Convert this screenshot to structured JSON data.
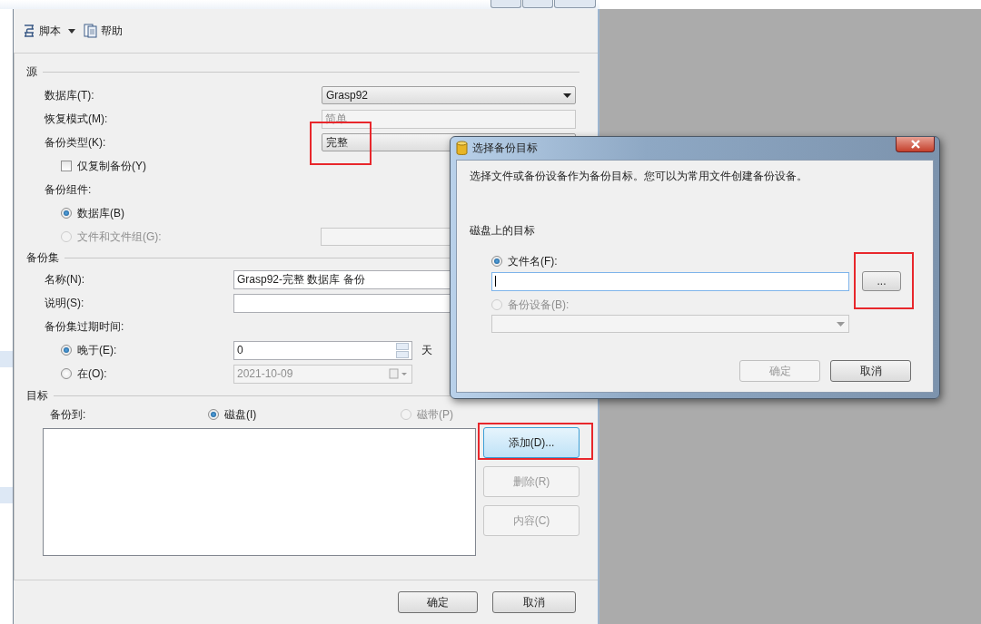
{
  "main_window": {
    "toolbar": [
      {
        "kind": "script",
        "label": "脚本",
        "dropdown": true
      },
      {
        "kind": "help",
        "label": "帮助",
        "dropdown": false
      }
    ],
    "source": {
      "title": "源",
      "database": {
        "label": "数据库(T):",
        "value": "Grasp92"
      },
      "recovery_model": {
        "label": "恢复模式(M):",
        "value": "简单",
        "disabled": true
      },
      "backup_type": {
        "label": "备份类型(K):",
        "value": "完整",
        "highlighted": true
      },
      "copy_only": {
        "label": "仅复制备份(Y)",
        "checked": false
      },
      "component": {
        "label": "备份组件:",
        "options": [
          {
            "label": "数据库(B)",
            "selected": true,
            "disabled": false
          },
          {
            "label": "文件和文件组(G):",
            "selected": false,
            "disabled": true
          }
        ]
      }
    },
    "backup_set": {
      "title": "备份集",
      "name": {
        "label": "名称(N):",
        "value": "Grasp92-完整 数据库 备份"
      },
      "description": {
        "label": "说明(S):"
      },
      "expiry": {
        "label": "备份集过期时间:",
        "options": [
          {
            "kind": "spin",
            "label": "晚于(E):",
            "selected": true,
            "value": "0",
            "unit": "天"
          },
          {
            "kind": "date",
            "label": "在(O):",
            "selected": false,
            "value": "2021-10-09"
          }
        ]
      }
    },
    "destination": {
      "title": "目标",
      "backup_to": "备份到:",
      "media": [
        {
          "label": "磁盘(I)",
          "selected": true,
          "disabled": false
        },
        {
          "label": "磁带(P)",
          "selected": false,
          "disabled": true
        }
      ],
      "buttons": [
        {
          "label": "添加(D)...",
          "disabled": false,
          "highlighted": true
        },
        {
          "label": "删除(R)",
          "disabled": true,
          "highlighted": false
        },
        {
          "label": "内容(C)",
          "disabled": true,
          "highlighted": false
        }
      ]
    },
    "footer": [
      {
        "label": "确定"
      },
      {
        "label": "取消"
      }
    ]
  },
  "dialog": {
    "title": "选择备份目标",
    "description": "选择文件或备份设备作为备份目标。您可以为常用文件创建备份设备。",
    "section": "磁盘上的目标",
    "options": [
      {
        "kind": "file",
        "label": "文件名(F):",
        "selected": true,
        "disabled": false
      },
      {
        "kind": "device",
        "label": "备份设备(B):",
        "selected": false,
        "disabled": true
      }
    ],
    "browse": {
      "label": "...",
      "highlighted": true
    },
    "buttons": [
      {
        "label": "确定",
        "disabled": true
      },
      {
        "label": "取消",
        "disabled": false
      }
    ]
  }
}
